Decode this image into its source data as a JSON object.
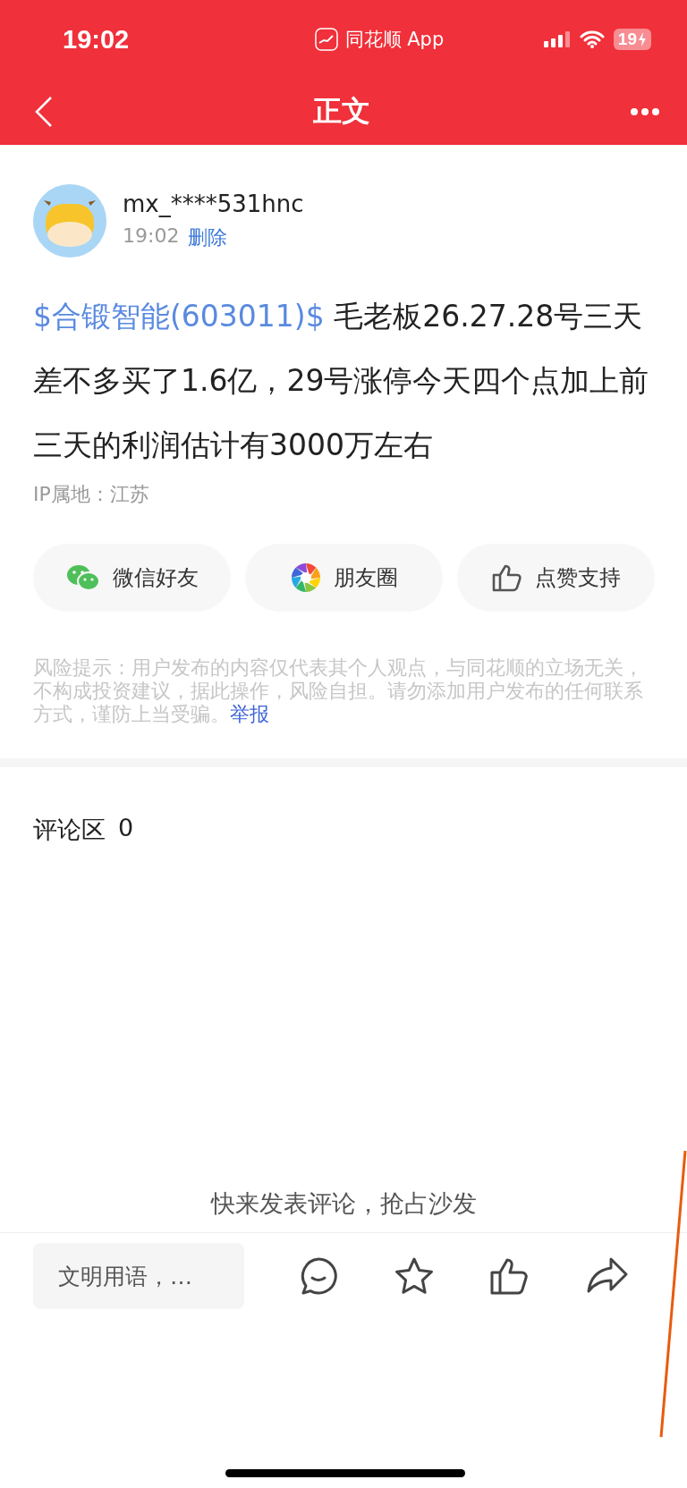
{
  "status_bar": {
    "time": "19:02",
    "app_name": "同花顺 App",
    "battery": "19"
  },
  "nav": {
    "title": "正文"
  },
  "post": {
    "author": "mx_****531hnc",
    "time": "19:02",
    "delete_link": "删除",
    "stock_tag": "$合锻智能(603011)$",
    "text": " 毛老板26.27.28号三天差不多买了1.6亿，29号涨停今天四个点加上前三天的利润估计有3000万左右",
    "ip_location": "IP属地：江苏"
  },
  "share_buttons": [
    {
      "kind": "wechat",
      "label": "微信好友"
    },
    {
      "kind": "moments",
      "label": "朋友圈"
    },
    {
      "kind": "like",
      "label": "点赞支持"
    }
  ],
  "risk_notice": {
    "text": "风险提示：用户发布的内容仅代表其个人观点，与同花顺的立场无关，不构成投资建议，据此操作，风险自担。请勿添加用户发布的任何联系方式，谨防上当受骗。",
    "report_link": "举报"
  },
  "comments": {
    "title": "评论区",
    "count": "0",
    "empty_text": "快来发表评论，抢占沙发"
  },
  "bottom_bar": {
    "placeholder": "文明用语，…",
    "actions": [
      {
        "kind": "comment"
      },
      {
        "kind": "favorite"
      },
      {
        "kind": "like"
      },
      {
        "kind": "share"
      }
    ]
  }
}
